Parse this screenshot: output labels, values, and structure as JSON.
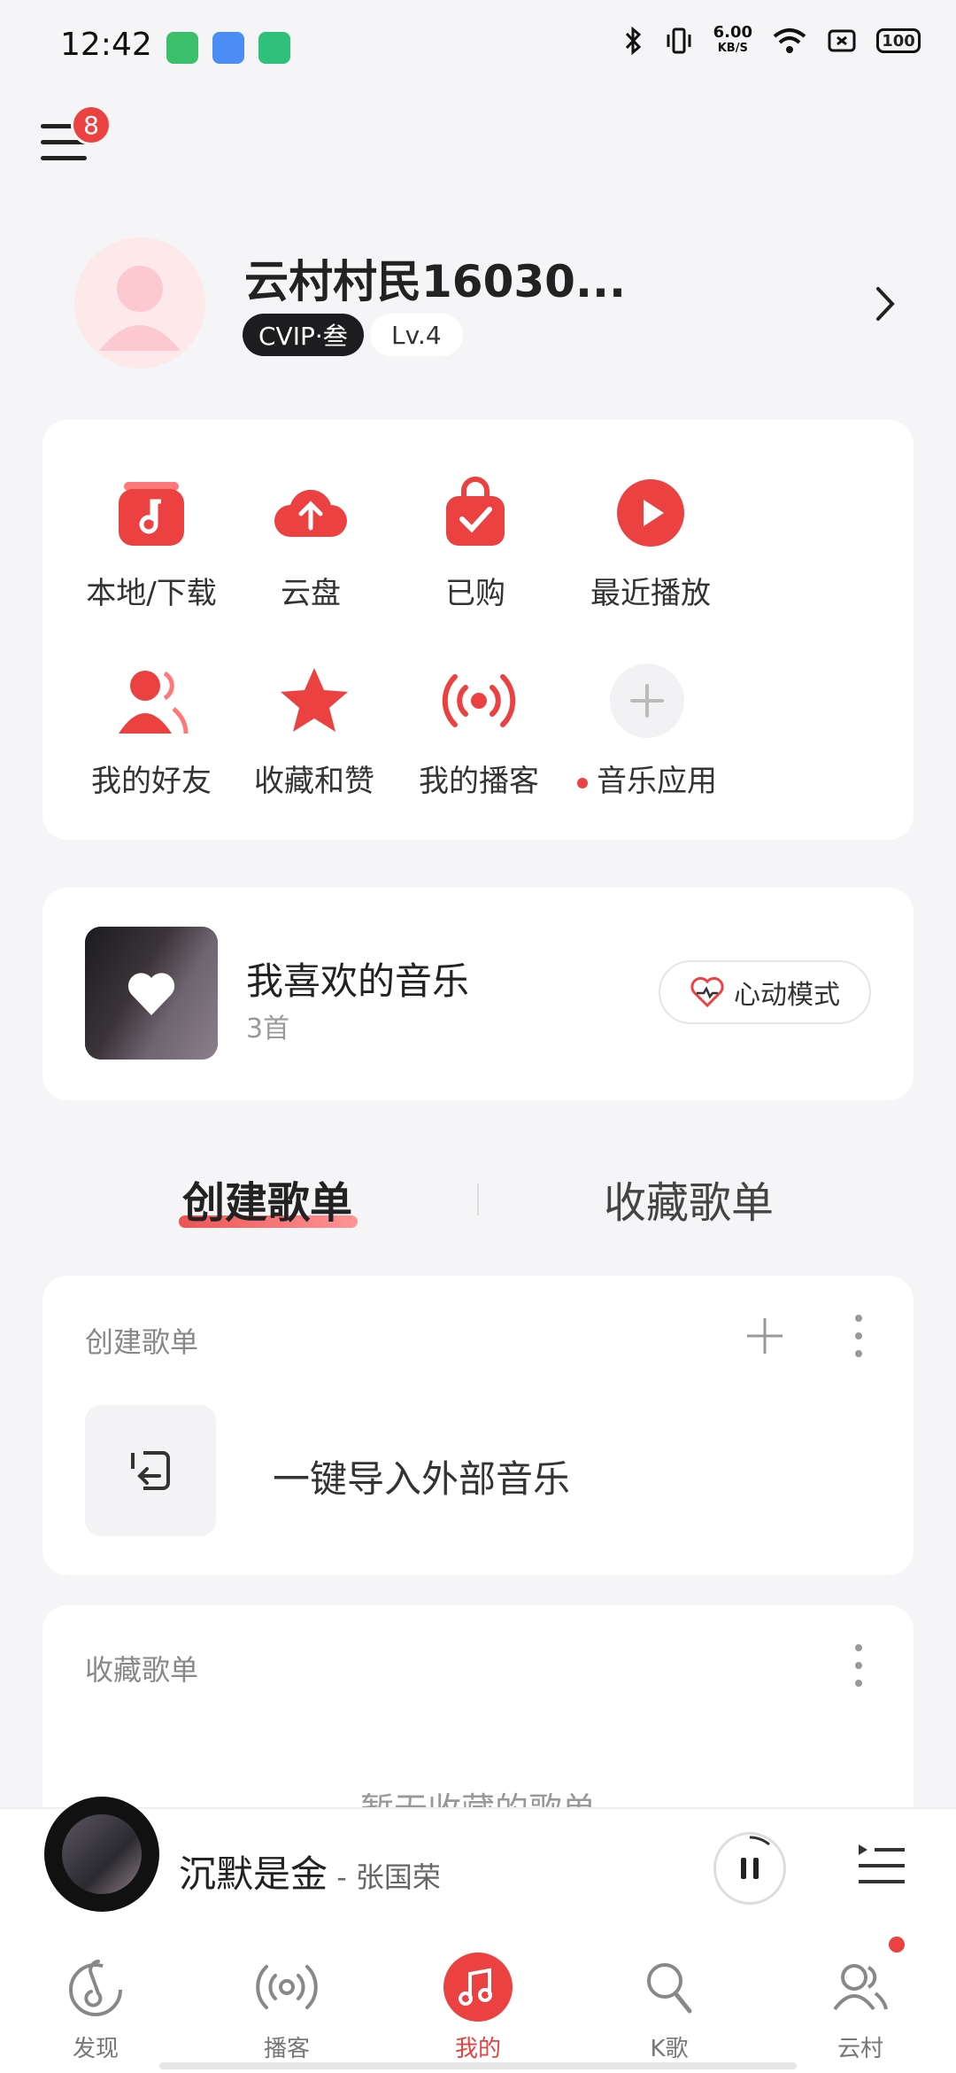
{
  "status_bar": {
    "time": "12:42",
    "net_speed_value": "6.00",
    "net_speed_unit": "KB/S",
    "battery": "100"
  },
  "header": {
    "menu_badge": "8"
  },
  "profile": {
    "username": "云村村民16030...",
    "vip_label": "CVIP·叁",
    "level": "Lv.4"
  },
  "quick_grid": {
    "items": [
      {
        "label": "本地/下载",
        "icon": "local-download-icon"
      },
      {
        "label": "云盘",
        "icon": "cloud-upload-icon"
      },
      {
        "label": "已购",
        "icon": "purchased-bag-icon"
      },
      {
        "label": "最近播放",
        "icon": "recent-play-icon"
      },
      {
        "label": "我的好友",
        "icon": "friends-icon"
      },
      {
        "label": "收藏和赞",
        "icon": "star-icon"
      },
      {
        "label": "我的播客",
        "icon": "podcast-icon"
      },
      {
        "label": "音乐应用",
        "icon": "add-icon"
      }
    ]
  },
  "favorite": {
    "title": "我喜欢的音乐",
    "count": "3首",
    "mode_button": "心动模式"
  },
  "tabs": {
    "created": "创建歌单",
    "collected": "收藏歌单"
  },
  "created_section": {
    "title": "创建歌单",
    "import_label": "一键导入外部音乐"
  },
  "collected_section": {
    "title": "收藏歌单",
    "empty_text": "暂无收藏的歌单"
  },
  "player": {
    "song": "沉默是金",
    "artist": " - 张国荣"
  },
  "bottom_nav": {
    "items": [
      {
        "label": "发现",
        "icon": "discover-icon"
      },
      {
        "label": "播客",
        "icon": "podcast-icon"
      },
      {
        "label": "我的",
        "icon": "music-note-icon"
      },
      {
        "label": "K歌",
        "icon": "microphone-icon"
      },
      {
        "label": "云村",
        "icon": "community-icon"
      }
    ],
    "active_index": 2
  },
  "colors": {
    "accent": "#ec4141",
    "background": "#f5f5f7"
  }
}
